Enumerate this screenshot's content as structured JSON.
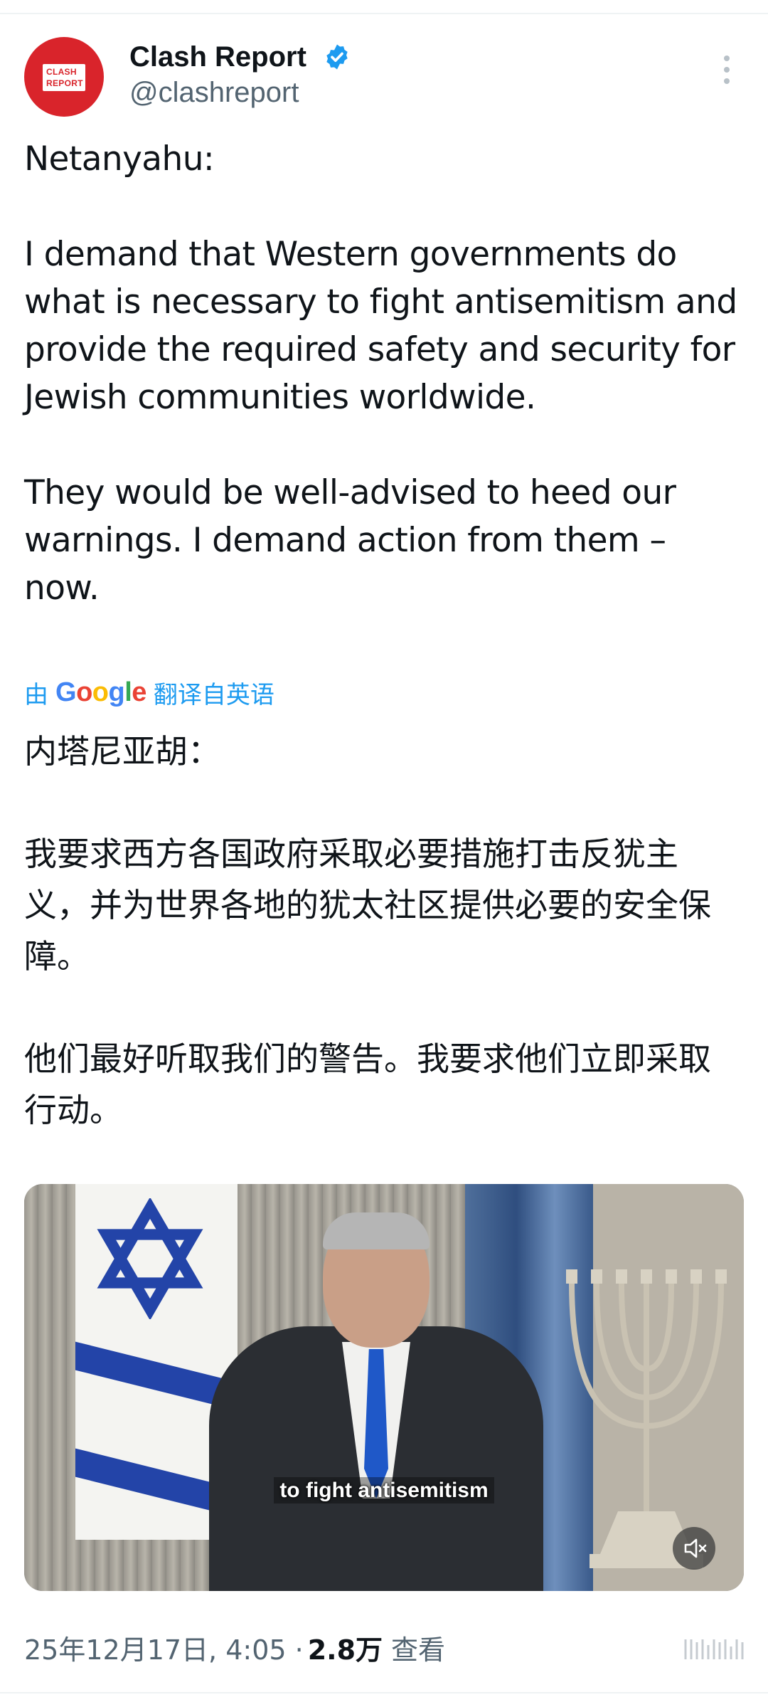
{
  "author": {
    "display_name": "Clash Report",
    "handle": "@clashreport",
    "avatar_text_line1": "CLASH",
    "avatar_text_line2": "REPORT",
    "verified": true
  },
  "tweet": {
    "original_paragraphs": [
      "Netanyahu:",
      "I demand that Western governments do what is necessary to fight antisemitism and provide the required safety and security for Jewish communities worldwide.",
      "They would be well-advised to heed our warnings. I demand action from them – now."
    ],
    "translation_prefix": "由",
    "translation_brand": "Google",
    "translation_suffix": "翻译自英语",
    "translated_paragraphs": [
      "内塔尼亚胡：",
      "我要求西方各国政府采取必要措施打击反犹主义，并为世界各地的犹太社区提供必要的安全保障。",
      "他们最好听取我们的警告。我要求他们立即采取行动。"
    ]
  },
  "media": {
    "subtitle": "to fight antisemitism",
    "mute_icon": "speaker-muted-icon"
  },
  "footer": {
    "timestamp": "25年12月17日, 4:05 ·",
    "views_count": "2.8万",
    "views_label": "查看"
  },
  "colors": {
    "accent": "#1d9bf0",
    "text_primary": "#0f1419",
    "text_secondary": "#536471",
    "avatar_red": "#d9242b"
  }
}
